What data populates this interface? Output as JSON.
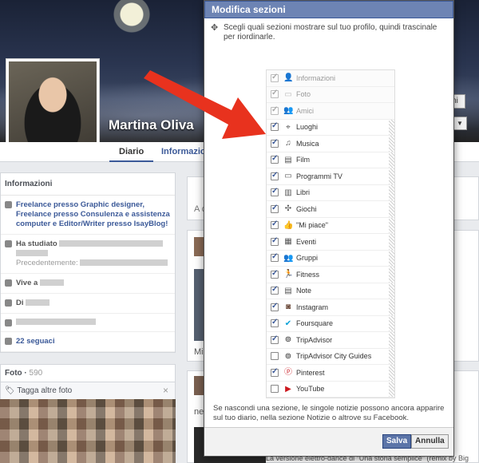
{
  "profile": {
    "name": "Martina Oliva",
    "tabs": [
      "Diario",
      "Informazioni"
    ],
    "cover_btn_label": "ni"
  },
  "info_card": {
    "title": "Informazioni",
    "work": "Freelance presso Graphic designer, Freelance presso Consulenza e assistenza computer e Editor/Writer presso IsayBlog!",
    "study_prefix": "Ha studiato",
    "previous_label": "Precedentemente:",
    "lives_prefix": "Vive a",
    "from_prefix": "Di",
    "followers": "22 seguaci"
  },
  "photos": {
    "title": "Foto",
    "count": "590",
    "tag_label": "Tagga altre foto",
    "close": "×"
  },
  "right_col": {
    "post_snip_1": "A c",
    "post_snip_2": "Mi p",
    "post_snip_3": "neg",
    "footer_snip": "La versione elettro-dance di \"Una storia semplice\" (remix by Big"
  },
  "modal": {
    "title": "Modifica sezioni",
    "description": "Scegli quali sezioni mostrare sul tuo profilo, quindi trascinale per riordinarle.",
    "sections": [
      {
        "label": "Informazioni",
        "checked": true,
        "locked": true,
        "icon": "person-icon"
      },
      {
        "label": "Foto",
        "checked": true,
        "locked": true,
        "icon": "photo-icon"
      },
      {
        "label": "Amici",
        "checked": true,
        "locked": true,
        "icon": "friends-icon"
      },
      {
        "label": "Luoghi",
        "checked": true,
        "locked": false,
        "icon": "map-pin-icon"
      },
      {
        "label": "Musica",
        "checked": true,
        "locked": false,
        "icon": "music-note-icon"
      },
      {
        "label": "Film",
        "checked": true,
        "locked": false,
        "icon": "film-icon"
      },
      {
        "label": "Programmi TV",
        "checked": true,
        "locked": false,
        "icon": "tv-icon"
      },
      {
        "label": "Libri",
        "checked": true,
        "locked": false,
        "icon": "book-icon"
      },
      {
        "label": "Giochi",
        "checked": true,
        "locked": false,
        "icon": "puzzle-icon"
      },
      {
        "label": "\"Mi piace\"",
        "checked": true,
        "locked": false,
        "icon": "thumbs-up-icon"
      },
      {
        "label": "Eventi",
        "checked": true,
        "locked": false,
        "icon": "calendar-icon"
      },
      {
        "label": "Gruppi",
        "checked": true,
        "locked": false,
        "icon": "group-icon"
      },
      {
        "label": "Fitness",
        "checked": true,
        "locked": false,
        "icon": "runner-icon"
      },
      {
        "label": "Note",
        "checked": true,
        "locked": false,
        "icon": "note-icon"
      },
      {
        "label": "Instagram",
        "checked": true,
        "locked": false,
        "icon": "instagram-icon"
      },
      {
        "label": "Foursquare",
        "checked": true,
        "locked": false,
        "icon": "foursquare-icon"
      },
      {
        "label": "TripAdvisor",
        "checked": true,
        "locked": false,
        "icon": "tripadvisor-icon"
      },
      {
        "label": "TripAdvisor City Guides",
        "checked": false,
        "locked": false,
        "icon": "tripadvisor-icon"
      },
      {
        "label": "Pinterest",
        "checked": true,
        "locked": false,
        "icon": "pinterest-icon"
      },
      {
        "label": "YouTube",
        "checked": false,
        "locked": false,
        "icon": "youtube-icon"
      }
    ],
    "note": "Se nascondi una sezione, le singole notizie possono ancora apparire sul tuo diario, nella sezione Notizie o altrove su Facebook.",
    "save_label": "Salva",
    "cancel_label": "Annulla"
  },
  "colors": {
    "fb_blue": "#3b5998",
    "modal_header": "#6d84b4",
    "arrow_red": "#e8321e"
  }
}
